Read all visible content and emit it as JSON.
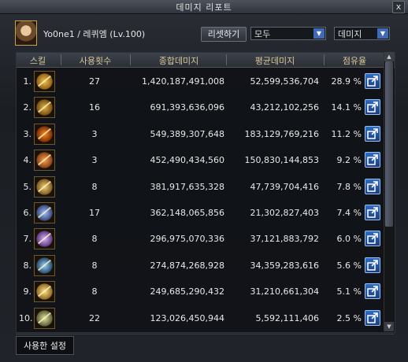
{
  "window": {
    "title": "데미지 리포트",
    "close_label": "x"
  },
  "header": {
    "player": "Yo0ne1 / 레퀴엠 (Lv.100)",
    "reset_label": "리셋하기",
    "filter_select": "모두",
    "sort_select": "데미지"
  },
  "table": {
    "columns": [
      "스킬",
      "사용횟수",
      "종합데미지",
      "평균데미지",
      "점유율"
    ],
    "rows": [
      {
        "rank": "1.",
        "icon": "skill-blade-arc-icon",
        "count": "27",
        "total": "1,420,187,491,008",
        "avg": "52,599,536,704",
        "share": "28.9 %"
      },
      {
        "rank": "2.",
        "icon": "skill-cross-slash-icon",
        "count": "16",
        "total": "691,393,636,096",
        "avg": "43,212,102,256",
        "share": "14.1 %"
      },
      {
        "rank": "3.",
        "icon": "skill-fire-ring-icon",
        "count": "3",
        "total": "549,389,307,648",
        "avg": "183,129,769,216",
        "share": "11.2 %"
      },
      {
        "rank": "4.",
        "icon": "skill-burst-strike-icon",
        "count": "3",
        "total": "452,490,434,560",
        "avg": "150,830,144,853",
        "share": "9.2 %"
      },
      {
        "rank": "5.",
        "icon": "skill-rune-seal-icon",
        "count": "8",
        "total": "381,917,635,328",
        "avg": "47,739,704,416",
        "share": "7.8 %"
      },
      {
        "rank": "6.",
        "icon": "skill-shock-wave-icon",
        "count": "17",
        "total": "362,148,065,856",
        "avg": "21,302,827,403",
        "share": "7.4 %"
      },
      {
        "rank": "7.",
        "icon": "skill-whirl-icon",
        "count": "8",
        "total": "296,975,070,336",
        "avg": "37,121,883,792",
        "share": "6.0 %"
      },
      {
        "rank": "8.",
        "icon": "skill-dark-orb-icon",
        "count": "8",
        "total": "274,874,268,928",
        "avg": "34,359,283,616",
        "share": "5.6 %"
      },
      {
        "rank": "9.",
        "icon": "skill-light-lance-icon",
        "count": "8",
        "total": "249,685,290,432",
        "avg": "31,210,661,304",
        "share": "5.1 %"
      },
      {
        "rank": "10.",
        "icon": "skill-target-mark-icon",
        "count": "22",
        "total": "123,026,450,944",
        "avg": "5,592,111,406",
        "share": "2.5 %"
      }
    ]
  },
  "footer": {
    "tab_label": "사용한 설정"
  },
  "colors": {
    "accent_blue": "#2e6cc0",
    "header_text": "#d9c89a"
  }
}
